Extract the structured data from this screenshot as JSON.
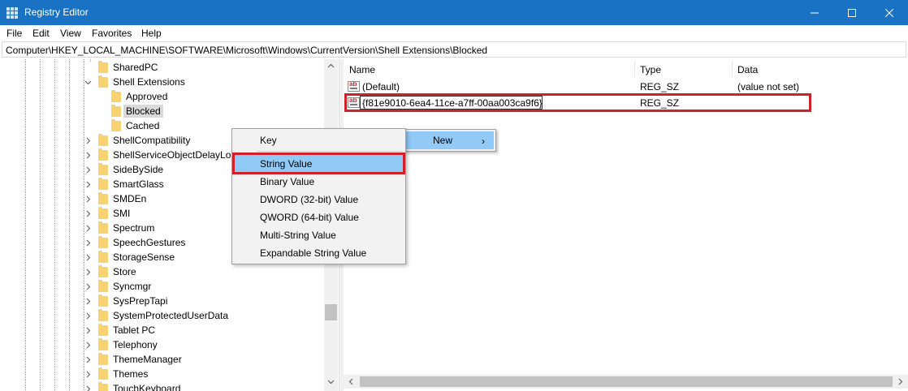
{
  "window": {
    "title": "Registry Editor"
  },
  "menu": [
    "File",
    "Edit",
    "View",
    "Favorites",
    "Help"
  ],
  "address": "Computer\\HKEY_LOCAL_MACHINE\\SOFTWARE\\Microsoft\\Windows\\CurrentVersion\\Shell Extensions\\Blocked",
  "tree": {
    "items": [
      "SharedPC",
      "Shell Extensions",
      "Approved",
      "Blocked",
      "Cached",
      "ShellCompatibility",
      "ShellServiceObjectDelayLoa",
      "SideBySide",
      "SmartGlass",
      "SMDEn",
      "SMI",
      "Spectrum",
      "SpeechGestures",
      "StorageSense",
      "Store",
      "Syncmgr",
      "SysPrepTapi",
      "SystemProtectedUserData",
      "Tablet PC",
      "Telephony",
      "ThemeManager",
      "Themes",
      "TouchKeyboard"
    ],
    "selected": "Blocked"
  },
  "values": {
    "headers": {
      "name": "Name",
      "type": "Type",
      "data": "Data"
    },
    "rows": [
      {
        "name": "(Default)",
        "type": "REG_SZ",
        "data": "(value not set)"
      },
      {
        "name": "{f81e9010-6ea4-11ce-a7ff-00aa003ca9f6}",
        "type": "REG_SZ",
        "data": ""
      }
    ]
  },
  "context_menu": {
    "new_label": "New",
    "submenu": [
      "Key",
      "String Value",
      "Binary Value",
      "DWORD (32-bit) Value",
      "QWORD (64-bit) Value",
      "Multi-String Value",
      "Expandable String Value"
    ],
    "active": "String Value"
  },
  "colors": {
    "titlebar": "#1a72c4",
    "menu_highlight": "#91c9f7",
    "annotation_red": "#d0202a",
    "folder": "#f6d270"
  }
}
